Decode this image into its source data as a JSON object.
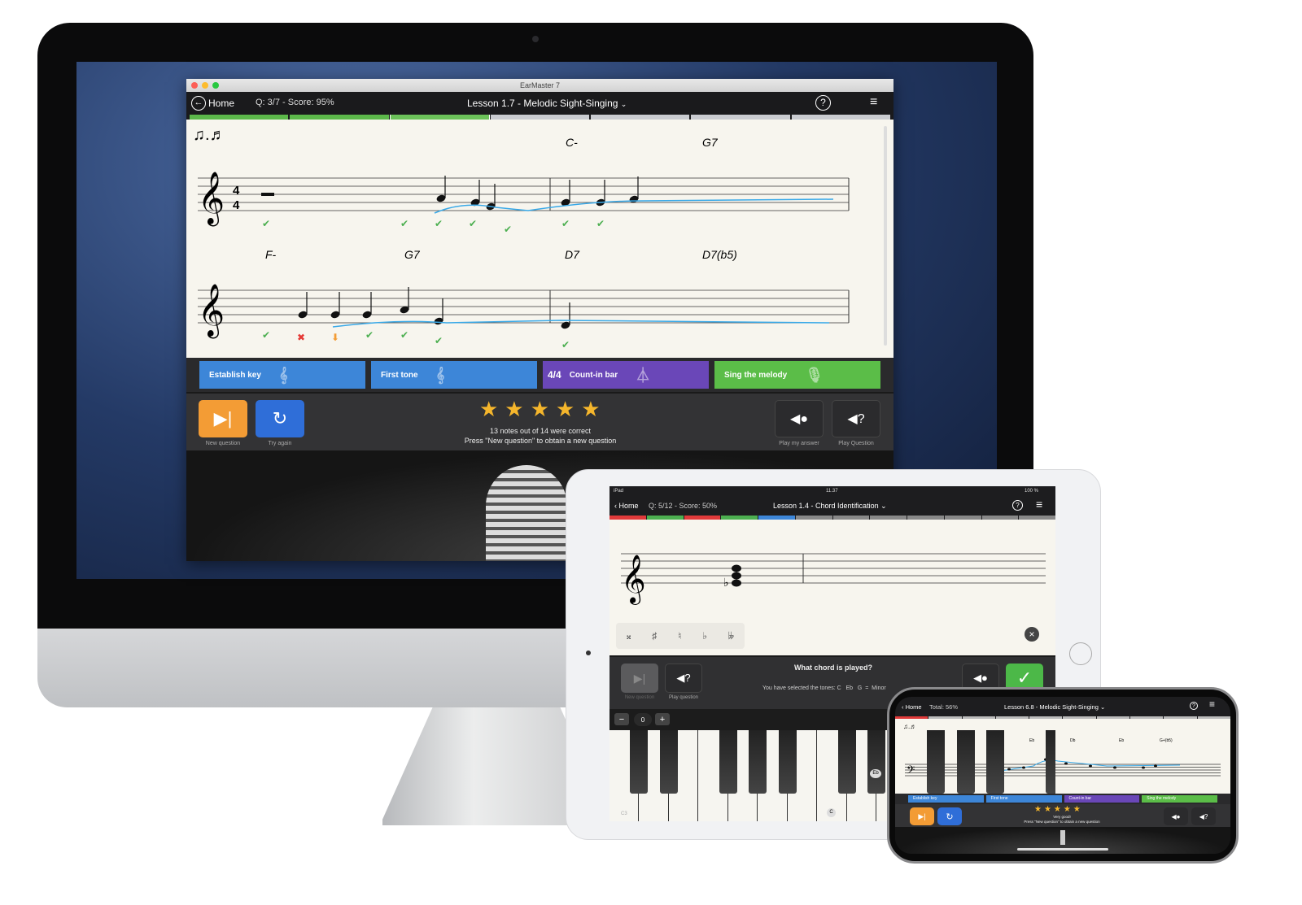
{
  "desktop": {
    "window_title": "EarMaster 7",
    "home_label": "Home",
    "q_score": "Q: 3/7 - Score: 95%",
    "lesson_title": "Lesson 1.7 - Melodic Sight-Singing",
    "progress": [
      "done",
      "done",
      "current",
      "todo",
      "todo",
      "todo",
      "todo"
    ],
    "chords_row1": [
      "C-",
      "G7"
    ],
    "chords_row2": [
      "F-",
      "G7",
      "D7",
      "D7(b5)"
    ],
    "steps": [
      {
        "label": "Establish key",
        "color": "#3d86d8",
        "icon": "treble-clef-icon"
      },
      {
        "label": "First tone",
        "color": "#3d86d8",
        "icon": "treble-clef-icon"
      },
      {
        "label": "Count-in bar",
        "color": "#6a47b8",
        "icon": "metronome-icon",
        "time_sig": "4/4"
      },
      {
        "label": "Sing the melody",
        "color": "#5bbd48",
        "icon": "microphone-icon"
      }
    ],
    "stars": 5,
    "result_line1": "13 notes out of 14 were correct",
    "result_line2": "Press \"New question\" to obtain a new question",
    "new_question": "New question",
    "try_again": "Try again",
    "play_answer": "Play my answer",
    "play_question": "Play Question"
  },
  "ipad": {
    "status_device": "iPad",
    "status_time": "11.37",
    "status_battery": "100 %",
    "home_label": "Home",
    "q_score": "Q: 5/12 - Score: 50%",
    "lesson_title": "Lesson 1.4 - Chord Identification",
    "accidentals": [
      "𝄪",
      "♯",
      "♮",
      "♭",
      "𝄫"
    ],
    "question": "What chord is played?",
    "selection": "You have selected the tones: C   Eb   G  =  Minor",
    "new_question": "New question",
    "play_question": "Play question",
    "octave_value": "0",
    "key_c3": "C3",
    "key_c": "C",
    "key_eb": "Eb"
  },
  "iphone": {
    "home_label": "Home",
    "total": "Total: 56%",
    "lesson_title": "Lesson 6.8 - Melodic Sight-Singing",
    "chords": [
      "Eb",
      "Db",
      "Eb",
      "G+(b5)"
    ],
    "steps": [
      "Establish key",
      "First tone",
      "Count-in bar",
      "Sing the melody"
    ],
    "result_line1": "Very good!",
    "result_line2": "Press \"New question\" to obtain a new question"
  }
}
